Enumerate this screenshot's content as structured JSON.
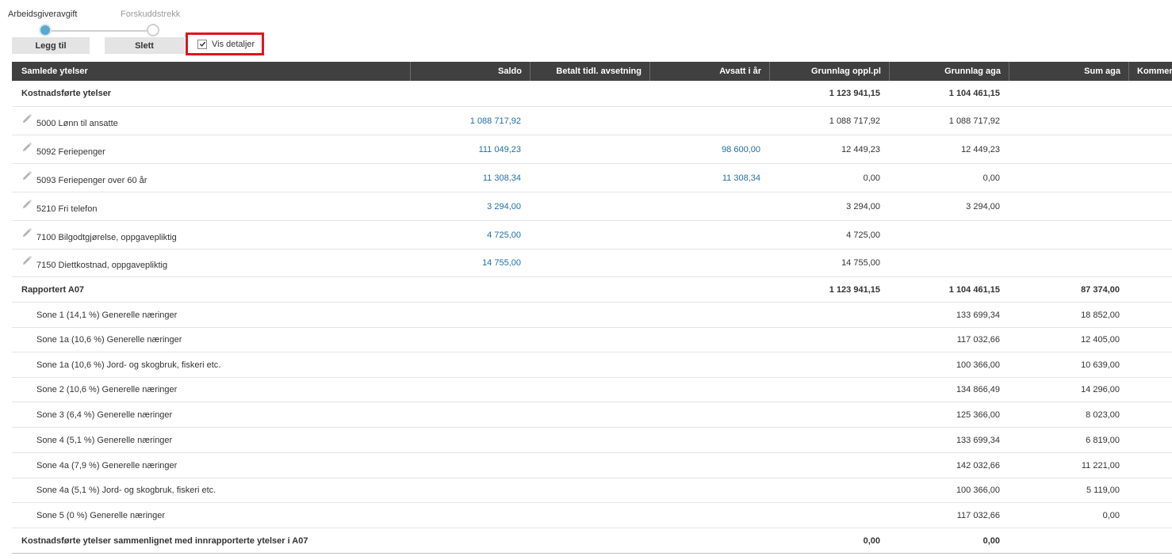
{
  "stepper": {
    "steps": [
      {
        "label": "Arbeidsgiveravgift",
        "active": true
      },
      {
        "label": "Forskuddstrekk",
        "active": false
      }
    ]
  },
  "toolbar": {
    "add_label": "Legg til",
    "delete_label": "Slett",
    "details_label": "Vis detaljer",
    "details_checked": true
  },
  "colors": {
    "header_bg": "#404040",
    "link": "#1f6fa8",
    "highlight": "#e3131d",
    "active_step": "#5aa7cf"
  },
  "table": {
    "columns": [
      "Samlede ytelser",
      "Saldo",
      "Betalt tidl. avsetning",
      "Avsatt i år",
      "Grunnlag oppl.pl",
      "Grunnlag aga",
      "Sum aga",
      "Kommer"
    ],
    "rows": [
      {
        "type": "group",
        "name": "Kostnadsførte ytelser",
        "saldo": "",
        "betalt": "",
        "avsatt": "",
        "oppl": "1 123 941,15",
        "aga": "1 104 461,15",
        "sum": ""
      },
      {
        "type": "editable",
        "icon": "pencil-icon",
        "name": "5000 Lønn til ansatte",
        "saldo": "1 088 717,92",
        "betalt": "",
        "avsatt": "",
        "oppl": "1 088 717,92",
        "aga": "1 088 717,92",
        "sum": ""
      },
      {
        "type": "editable",
        "icon": "pencil-icon",
        "name": "5092 Feriepenger",
        "saldo": "111 049,23",
        "betalt": "",
        "avsatt": "98 600,00",
        "oppl": "12 449,23",
        "aga": "12 449,23",
        "sum": ""
      },
      {
        "type": "editable",
        "icon": "pencil-icon",
        "name": "5093 Feriepenger over 60 år",
        "saldo": "11 308,34",
        "betalt": "",
        "avsatt": "11 308,34",
        "oppl": "0,00",
        "aga": "0,00",
        "sum": ""
      },
      {
        "type": "editable",
        "icon": "pencil-icon",
        "name": "5210 Fri telefon",
        "saldo": "3 294,00",
        "betalt": "",
        "avsatt": "",
        "oppl": "3 294,00",
        "aga": "3 294,00",
        "sum": ""
      },
      {
        "type": "editable",
        "icon": "pencil-icon",
        "name": "7100 Bilgodtgjørelse, oppgavepliktig",
        "saldo": "4 725,00",
        "betalt": "",
        "avsatt": "",
        "oppl": "4 725,00",
        "aga": "",
        "sum": ""
      },
      {
        "type": "editable",
        "icon": "pencil-icon",
        "name": "7150 Diettkostnad, oppgavepliktig",
        "saldo": "14 755,00",
        "betalt": "",
        "avsatt": "",
        "oppl": "14 755,00",
        "aga": "",
        "sum": ""
      },
      {
        "type": "group",
        "name": "Rapportert A07",
        "saldo": "",
        "betalt": "",
        "avsatt": "",
        "oppl": "1 123 941,15",
        "aga": "1 104 461,15",
        "sum": "87 374,00"
      },
      {
        "type": "sub",
        "name": "Sone 1 (14,1 %) Generelle næringer",
        "saldo": "",
        "betalt": "",
        "avsatt": "",
        "oppl": "",
        "aga": "133 699,34",
        "sum": "18 852,00"
      },
      {
        "type": "sub",
        "name": "Sone 1a (10,6 %) Generelle næringer",
        "saldo": "",
        "betalt": "",
        "avsatt": "",
        "oppl": "",
        "aga": "117 032,66",
        "sum": "12 405,00"
      },
      {
        "type": "sub",
        "name": "Sone 1a (10,6 %) Jord- og skogbruk, fiskeri etc.",
        "saldo": "",
        "betalt": "",
        "avsatt": "",
        "oppl": "",
        "aga": "100 366,00",
        "sum": "10 639,00"
      },
      {
        "type": "sub",
        "name": "Sone 2 (10,6 %) Generelle næringer",
        "saldo": "",
        "betalt": "",
        "avsatt": "",
        "oppl": "",
        "aga": "134 866,49",
        "sum": "14 296,00"
      },
      {
        "type": "sub",
        "name": "Sone 3 (6,4 %) Generelle næringer",
        "saldo": "",
        "betalt": "",
        "avsatt": "",
        "oppl": "",
        "aga": "125 366,00",
        "sum": "8 023,00"
      },
      {
        "type": "sub",
        "name": "Sone 4 (5,1 %) Generelle næringer",
        "saldo": "",
        "betalt": "",
        "avsatt": "",
        "oppl": "",
        "aga": "133 699,34",
        "sum": "6 819,00"
      },
      {
        "type": "sub",
        "name": "Sone 4a (7,9 %) Generelle næringer",
        "saldo": "",
        "betalt": "",
        "avsatt": "",
        "oppl": "",
        "aga": "142 032,66",
        "sum": "11 221,00"
      },
      {
        "type": "sub",
        "name": "Sone 4a (5,1 %) Jord- og skogbruk, fiskeri etc.",
        "saldo": "",
        "betalt": "",
        "avsatt": "",
        "oppl": "",
        "aga": "100 366,00",
        "sum": "5 119,00"
      },
      {
        "type": "sub",
        "name": "Sone 5 (0 %) Generelle næringer",
        "saldo": "",
        "betalt": "",
        "avsatt": "",
        "oppl": "",
        "aga": "117 032,66",
        "sum": "0,00"
      },
      {
        "type": "group",
        "name": "Kostnadsførte ytelser sammenlignet med innrapporterte ytelser i A07",
        "saldo": "",
        "betalt": "",
        "avsatt": "",
        "oppl": "0,00",
        "aga": "0,00",
        "sum": ""
      }
    ]
  }
}
